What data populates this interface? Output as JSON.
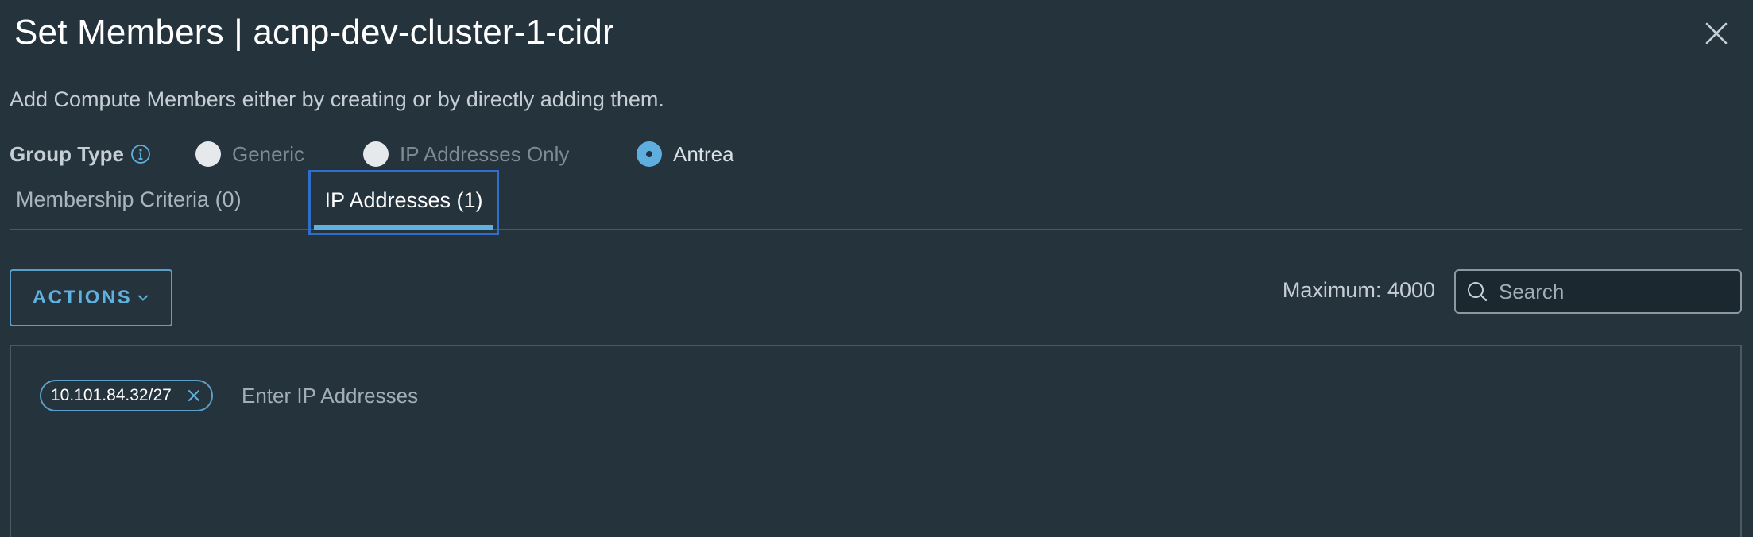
{
  "dialog": {
    "title": "Set Members | acnp-dev-cluster-1-cidr",
    "description": "Add Compute Members either by creating or by directly adding them."
  },
  "group_type": {
    "label": "Group Type",
    "options": [
      {
        "label": "Generic",
        "selected": false
      },
      {
        "label": "IP Addresses Only",
        "selected": false
      },
      {
        "label": "Antrea",
        "selected": true
      }
    ]
  },
  "tabs": [
    {
      "label": "Membership Criteria (0)",
      "active": false
    },
    {
      "label": "IP Addresses (1)",
      "active": true
    }
  ],
  "toolbar": {
    "actions_label": "ACTIONS",
    "maximum_text": "Maximum: 4000",
    "search_placeholder": "Search",
    "search_value": ""
  },
  "ip_addresses": {
    "chips": [
      "10.101.84.32/27"
    ],
    "input_placeholder": "Enter IP Addresses",
    "input_value": ""
  },
  "icons": {
    "close": "close-icon",
    "info": "info-icon",
    "chevron": "chevron-down-icon",
    "search": "search-icon",
    "chip_remove": "remove-chip-icon"
  },
  "colors": {
    "background": "#25333d",
    "accent": "#5fb2e0",
    "focus_outline": "#2f6fc9",
    "text": "#d3dae0"
  }
}
